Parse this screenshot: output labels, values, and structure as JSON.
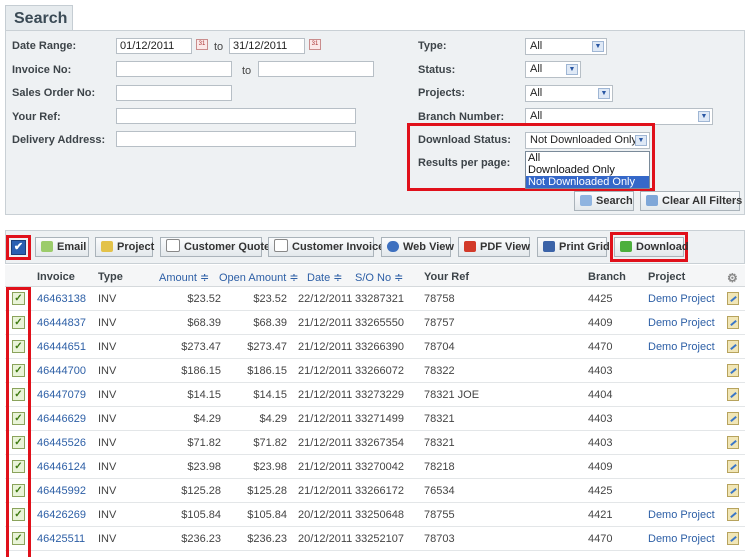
{
  "search": {
    "tab_label": "Search",
    "date_range_label": "Date Range:",
    "date_from": "01/12/2011",
    "to_label": "to",
    "date_to": "31/12/2011",
    "invoice_no_label": "Invoice No:",
    "invoice_to_label": "to",
    "sales_order_label": "Sales Order No:",
    "your_ref_label": "Your Ref:",
    "delivery_address_label": "Delivery Address:",
    "type_label": "Type:",
    "type_value": "All",
    "status_label": "Status:",
    "status_value": "All",
    "projects_label": "Projects:",
    "projects_value": "All",
    "branch_label": "Branch Number:",
    "branch_value": "All",
    "download_status_label": "Download Status:",
    "download_status_value": "Not Downloaded Only",
    "download_status_options": [
      "All",
      "Downloaded Only",
      "Not Downloaded Only"
    ],
    "results_per_page_label": "Results per page:",
    "search_button": "Search",
    "clear_filters_button": "Clear All Filters"
  },
  "toolbar": {
    "email": "Email",
    "project": "Project",
    "customer_quote": "Customer Quote",
    "customer_invoice": "Customer Invoice",
    "web_view": "Web View",
    "pdf_view": "PDF View",
    "print_grid": "Print Grid",
    "download": "Download"
  },
  "table": {
    "headers": {
      "invoice": "Invoice",
      "type": "Type",
      "amount": "Amount ≑",
      "open_amount": "Open Amount ≑",
      "date": "Date ≑",
      "so_no": "S/O No ≑",
      "your_ref": "Your Ref",
      "branch": "Branch",
      "project": "Project"
    },
    "rows": [
      {
        "invoice": "46463138",
        "type": "INV",
        "amount": "$23.52",
        "open": "$23.52",
        "date": "22/12/2011",
        "so": "33287321",
        "ref": "78758",
        "branch": "4425",
        "project": "Demo Project"
      },
      {
        "invoice": "46444837",
        "type": "INV",
        "amount": "$68.39",
        "open": "$68.39",
        "date": "21/12/2011",
        "so": "33265550",
        "ref": "78757",
        "branch": "4409",
        "project": "Demo Project"
      },
      {
        "invoice": "46444651",
        "type": "INV",
        "amount": "$273.47",
        "open": "$273.47",
        "date": "21/12/2011",
        "so": "33266390",
        "ref": "78704",
        "branch": "4470",
        "project": "Demo Project"
      },
      {
        "invoice": "46444700",
        "type": "INV",
        "amount": "$186.15",
        "open": "$186.15",
        "date": "21/12/2011",
        "so": "33266072",
        "ref": "78322",
        "branch": "4403",
        "project": ""
      },
      {
        "invoice": "46447079",
        "type": "INV",
        "amount": "$14.15",
        "open": "$14.15",
        "date": "21/12/2011",
        "so": "33273229",
        "ref": "78321 JOE",
        "branch": "4404",
        "project": ""
      },
      {
        "invoice": "46446629",
        "type": "INV",
        "amount": "$4.29",
        "open": "$4.29",
        "date": "21/12/2011",
        "so": "33271499",
        "ref": "78321",
        "branch": "4403",
        "project": ""
      },
      {
        "invoice": "46445526",
        "type": "INV",
        "amount": "$71.82",
        "open": "$71.82",
        "date": "21/12/2011",
        "so": "33267354",
        "ref": "78321",
        "branch": "4403",
        "project": ""
      },
      {
        "invoice": "46446124",
        "type": "INV",
        "amount": "$23.98",
        "open": "$23.98",
        "date": "21/12/2011",
        "so": "33270042",
        "ref": "78218",
        "branch": "4409",
        "project": ""
      },
      {
        "invoice": "46445992",
        "type": "INV",
        "amount": "$125.28",
        "open": "$125.28",
        "date": "21/12/2011",
        "so": "33266172",
        "ref": "76534",
        "branch": "4425",
        "project": ""
      },
      {
        "invoice": "46426269",
        "type": "INV",
        "amount": "$105.84",
        "open": "$105.84",
        "date": "20/12/2011",
        "so": "33250648",
        "ref": "78755",
        "branch": "4421",
        "project": "Demo Project"
      },
      {
        "invoice": "46425511",
        "type": "INV",
        "amount": "$236.23",
        "open": "$236.23",
        "date": "20/12/2011",
        "so": "33252107",
        "ref": "78703",
        "branch": "4470",
        "project": "Demo Project"
      }
    ]
  },
  "colors": {
    "highlight": "#e0101a",
    "link": "#2d5fa6",
    "selected_option": "#3568c9"
  }
}
